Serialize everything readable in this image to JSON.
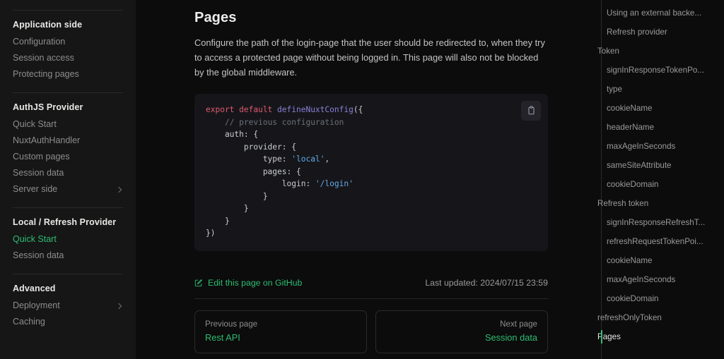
{
  "sidebar": {
    "groups": [
      {
        "title": "Application side",
        "items": [
          {
            "label": "Configuration",
            "active": false,
            "chevron": false
          },
          {
            "label": "Session access",
            "active": false,
            "chevron": false
          },
          {
            "label": "Protecting pages",
            "active": false,
            "chevron": false
          }
        ]
      },
      {
        "title": "AuthJS Provider",
        "items": [
          {
            "label": "Quick Start",
            "active": false,
            "chevron": false
          },
          {
            "label": "NuxtAuthHandler",
            "active": false,
            "chevron": false
          },
          {
            "label": "Custom pages",
            "active": false,
            "chevron": false
          },
          {
            "label": "Session data",
            "active": false,
            "chevron": false
          },
          {
            "label": "Server side",
            "active": false,
            "chevron": true
          }
        ]
      },
      {
        "title": "Local / Refresh Provider",
        "items": [
          {
            "label": "Quick Start",
            "active": true,
            "chevron": false
          },
          {
            "label": "Session data",
            "active": false,
            "chevron": false
          }
        ]
      },
      {
        "title": "Advanced",
        "items": [
          {
            "label": "Deployment",
            "active": false,
            "chevron": true
          },
          {
            "label": "Caching",
            "active": false,
            "chevron": false
          }
        ]
      }
    ]
  },
  "main": {
    "title": "Pages",
    "intro": "Configure the path of the login-page that the user should be redirected to, when they try to access a protected page without being logged in. This page will also not be blocked by the global middleware.",
    "code": {
      "copy_icon": "clipboard-icon",
      "lines": [
        [
          {
            "t": "export default ",
            "c": "kw"
          },
          {
            "t": "defineNuxtConfig",
            "c": "fn"
          },
          {
            "t": "({",
            "c": "pl"
          }
        ],
        [
          {
            "t": "    ",
            "c": "pl"
          },
          {
            "t": "// previous configuration",
            "c": "cm"
          }
        ],
        [
          {
            "t": "    auth: {",
            "c": "pl"
          }
        ],
        [
          {
            "t": "        provider: {",
            "c": "pl"
          }
        ],
        [
          {
            "t": "            type: ",
            "c": "pl"
          },
          {
            "t": "'local'",
            "c": "str"
          },
          {
            "t": ",",
            "c": "pl"
          }
        ],
        [
          {
            "t": "            pages: {",
            "c": "pl"
          }
        ],
        [
          {
            "t": "                login: ",
            "c": "pl"
          },
          {
            "t": "'/login'",
            "c": "str"
          }
        ],
        [
          {
            "t": "            }",
            "c": "pl"
          }
        ],
        [
          {
            "t": "        }",
            "c": "pl"
          }
        ],
        [
          {
            "t": "    }",
            "c": "pl"
          }
        ],
        [
          {
            "t": "})",
            "c": "pl"
          }
        ]
      ]
    },
    "edit_link": "Edit this page on GitHub",
    "edit_icon": "edit-pencil-icon",
    "last_updated": "Last updated: 2024/07/15 23:59",
    "pager": {
      "previous": {
        "kicker": "Previous page",
        "title": "Rest API"
      },
      "next": {
        "kicker": "Next page",
        "title": "Session data"
      }
    }
  },
  "toc": {
    "items": [
      {
        "label": "Using an external backe...",
        "level": 1,
        "active": false
      },
      {
        "label": "Refresh provider",
        "level": 1,
        "active": false
      },
      {
        "label": "Token",
        "level": 0,
        "active": false
      },
      {
        "label": "signInResponseTokenPo...",
        "level": 1,
        "active": false
      },
      {
        "label": "type",
        "level": 1,
        "active": false
      },
      {
        "label": "cookieName",
        "level": 1,
        "active": false
      },
      {
        "label": "headerName",
        "level": 1,
        "active": false
      },
      {
        "label": "maxAgeInSeconds",
        "level": 1,
        "active": false
      },
      {
        "label": "sameSiteAttribute",
        "level": 1,
        "active": false
      },
      {
        "label": "cookieDomain",
        "level": 1,
        "active": false
      },
      {
        "label": "Refresh token",
        "level": 0,
        "active": false
      },
      {
        "label": "signInResponseRefreshT...",
        "level": 1,
        "active": false
      },
      {
        "label": "refreshRequestTokenPoi...",
        "level": 1,
        "active": false
      },
      {
        "label": "cookieName",
        "level": 1,
        "active": false
      },
      {
        "label": "maxAgeInSeconds",
        "level": 1,
        "active": false
      },
      {
        "label": "cookieDomain",
        "level": 1,
        "active": false
      },
      {
        "label": "refreshOnlyToken",
        "level": 0,
        "active": false
      },
      {
        "label": "Pages",
        "level": 0,
        "active": true
      }
    ]
  },
  "colors": {
    "accent_green": "#2dbd72",
    "page_bg": "#0c0c0c",
    "sidebar_bg": "#161616",
    "code_bg": "#16161a"
  }
}
